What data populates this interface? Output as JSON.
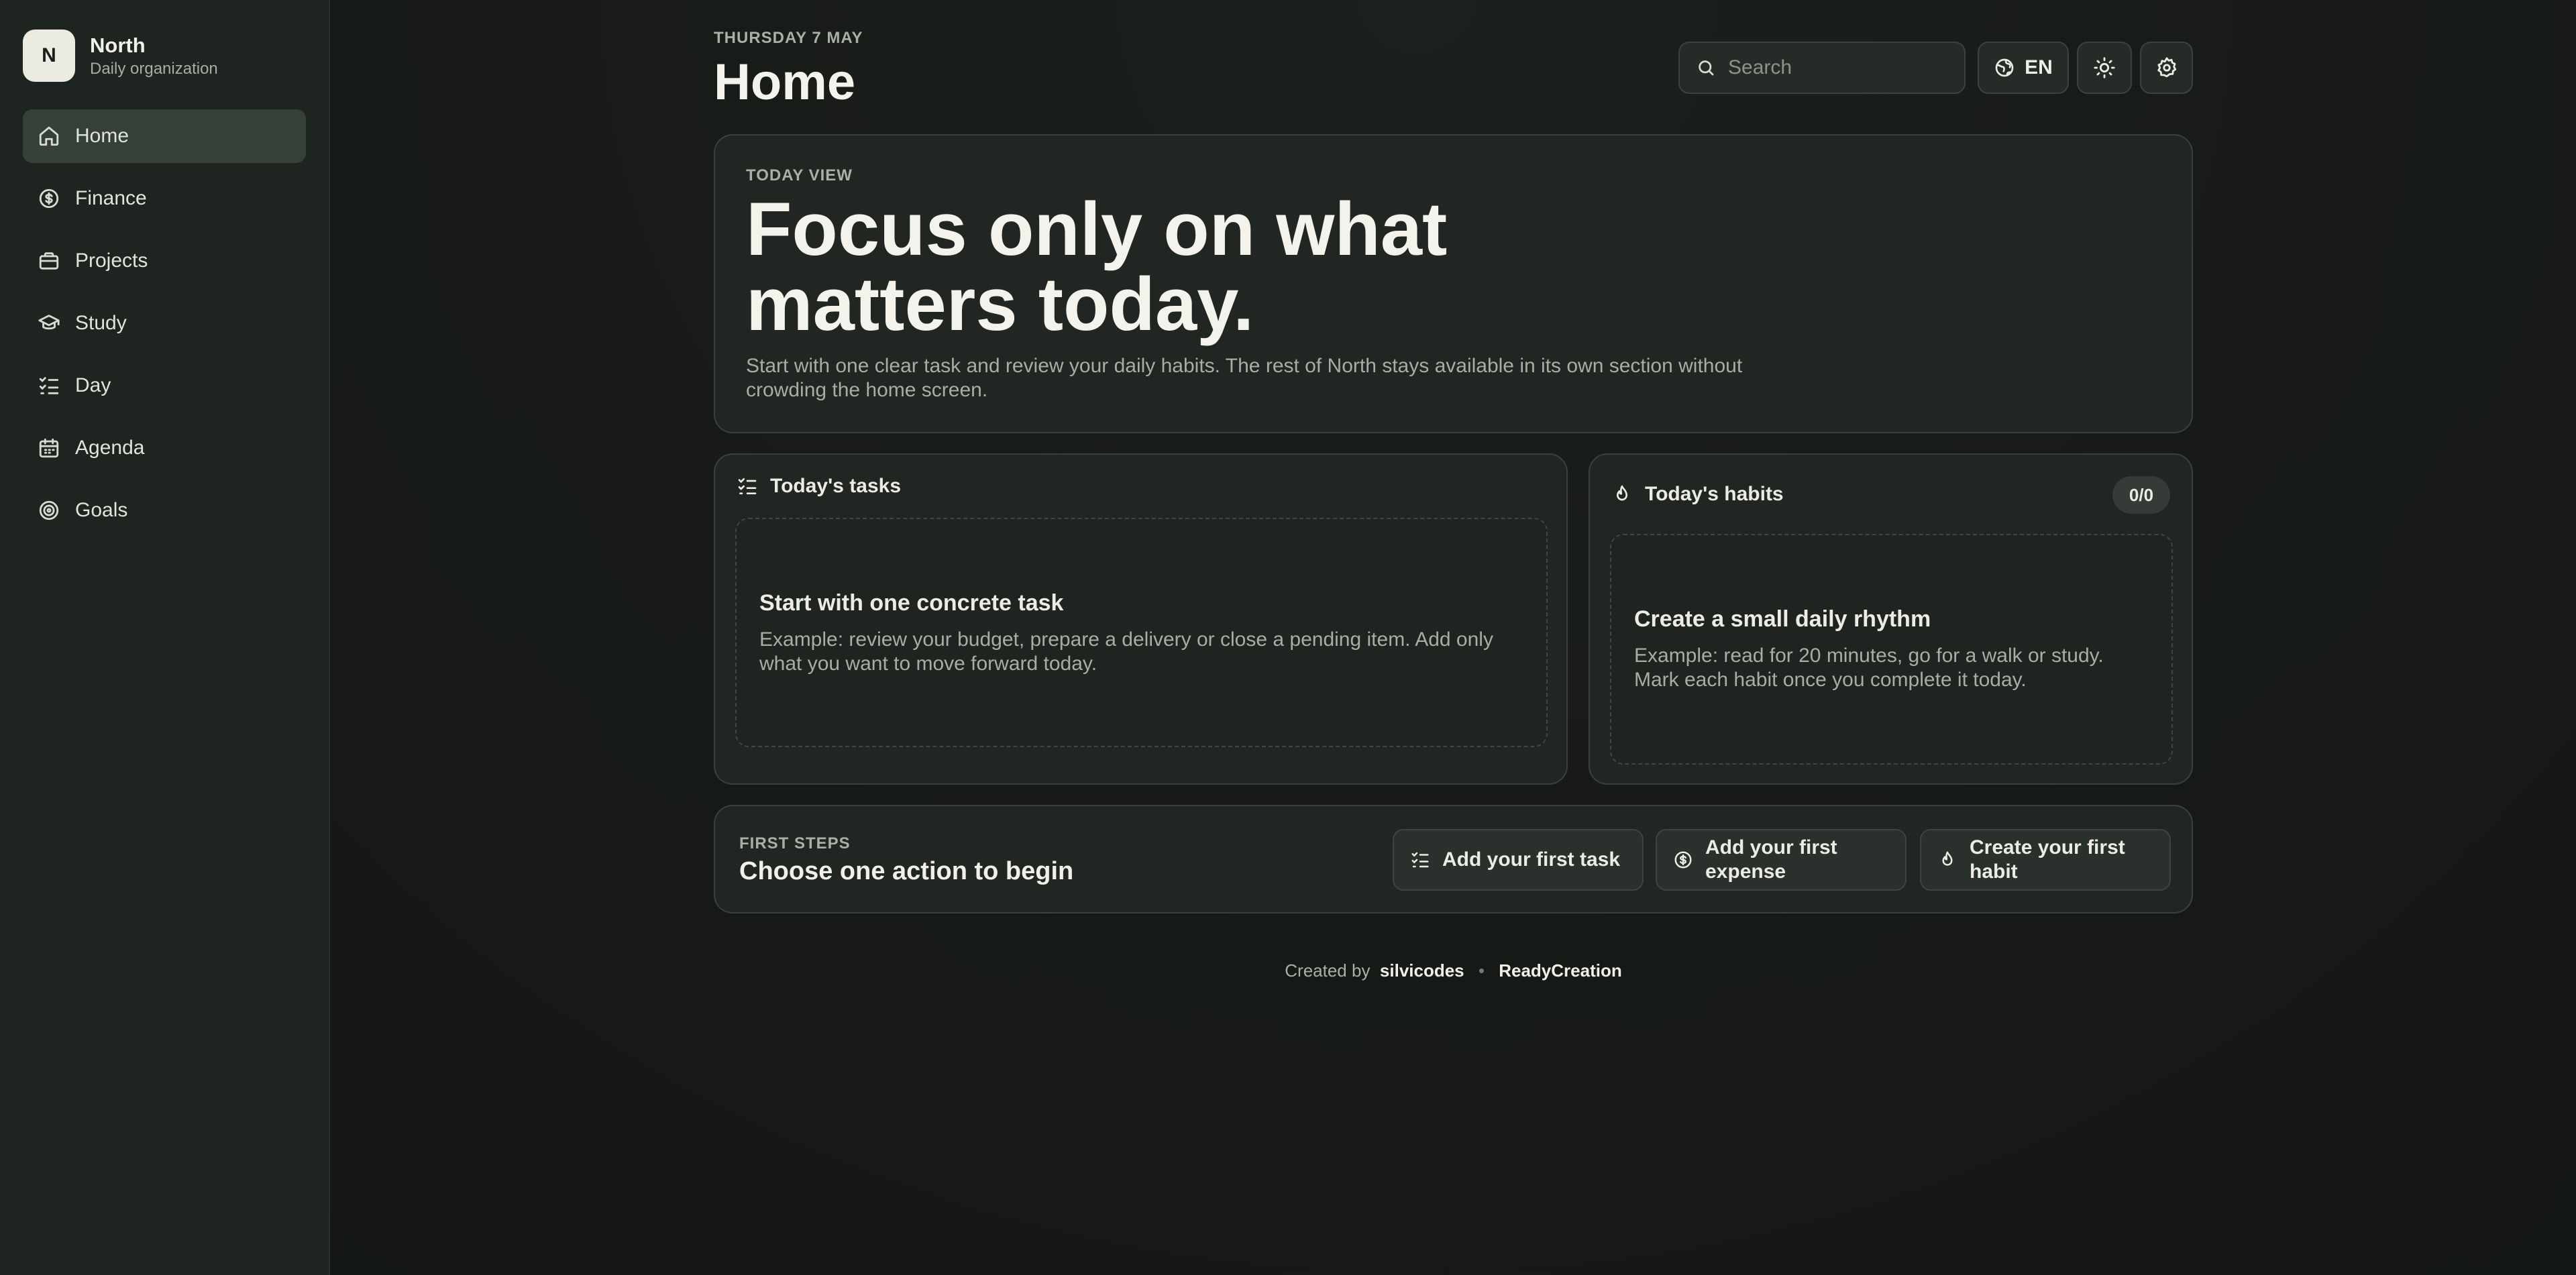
{
  "brand": {
    "logo_letter": "N",
    "name": "North",
    "subtitle": "Daily organization"
  },
  "sidebar": {
    "items": [
      {
        "label": "Home",
        "icon": "home-icon",
        "active": true
      },
      {
        "label": "Finance",
        "icon": "dollar-circle-icon"
      },
      {
        "label": "Projects",
        "icon": "briefcase-icon"
      },
      {
        "label": "Study",
        "icon": "graduation-cap-icon"
      },
      {
        "label": "Day",
        "icon": "list-checks-icon"
      },
      {
        "label": "Agenda",
        "icon": "calendar-icon"
      },
      {
        "label": "Goals",
        "icon": "target-icon"
      }
    ]
  },
  "header": {
    "date": "THURSDAY 7 MAY",
    "title": "Home",
    "search_placeholder": "Search",
    "language": "EN"
  },
  "hero": {
    "eyebrow": "TODAY VIEW",
    "title": "Focus only on what matters today.",
    "description": "Start with one clear task and review your daily habits. The rest of North stays available in its own section without crowding the home screen."
  },
  "tasks": {
    "heading": "Today's tasks",
    "empty_title": "Start with one concrete task",
    "empty_desc": "Example: review your budget, prepare a delivery or close a pending item. Add only what you want to move forward today."
  },
  "habits": {
    "heading": "Today's habits",
    "count": "0/0",
    "empty_title": "Create a small daily rhythm",
    "empty_desc": "Example: read for 20 minutes, go for a walk or study. Mark each habit once you complete it today."
  },
  "first_steps": {
    "eyebrow": "FIRST STEPS",
    "title": "Choose one action to begin",
    "actions": [
      "Add your first task",
      "Add your first expense",
      "Create your first habit"
    ]
  },
  "footer": {
    "prefix": "Created by",
    "author": "silvicodes",
    "separator": "•",
    "studio": "ReadyCreation"
  },
  "colors": {
    "background": "#171a17",
    "sidebar": "#1e2420",
    "active_item": "#344038",
    "card": "#212622",
    "text": "#e9e7df",
    "muted": "#a7aea6"
  }
}
